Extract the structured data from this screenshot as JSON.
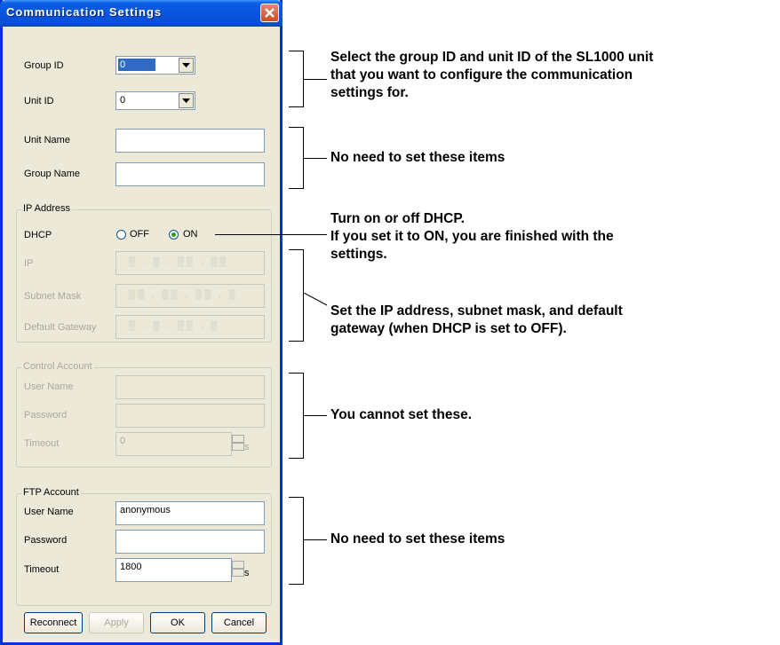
{
  "dialog": {
    "title": "Communication Settings",
    "close_icon": "close-icon"
  },
  "ids": {
    "group_id_label": "Group ID",
    "group_id_value": "0",
    "unit_id_label": "Unit ID",
    "unit_id_value": "0"
  },
  "names": {
    "unit_name_label": "Unit Name",
    "unit_name_value": "",
    "group_name_label": "Group Name",
    "group_name_value": ""
  },
  "ip": {
    "group_title": "IP Address",
    "dhcp_label": "DHCP",
    "off_label": "OFF",
    "on_label": "ON",
    "dhcp_selected": "ON",
    "ip_label": "IP",
    "subnet_label": "Subnet Mask",
    "gateway_label": "Default Gateway"
  },
  "control": {
    "group_title": "Control Account",
    "user_label": "User Name",
    "password_label": "Password",
    "timeout_label": "Timeout",
    "timeout_value": "0",
    "unit": "s"
  },
  "ftp": {
    "group_title": "FTP Account",
    "user_label": "User Name",
    "user_value": "anonymous",
    "password_label": "Password",
    "password_value": "",
    "timeout_label": "Timeout",
    "timeout_value": "1800",
    "unit": "s"
  },
  "buttons": {
    "reconnect": "Reconnect",
    "apply": "Apply",
    "ok": "OK",
    "cancel": "Cancel"
  },
  "annotations": {
    "a1_l1": "Select the group ID and unit ID of the SL1000 unit",
    "a1_l2": "that you want to configure the communication",
    "a1_l3": "settings for.",
    "a2": "No need to set these items",
    "a3_l1": "Turn on or off DHCP.",
    "a3_l2": "If you set it to ON, you are finished with the",
    "a3_l3": "settings.",
    "a4_l1": "Set the IP address, subnet mask, and default",
    "a4_l2": "gateway (when DHCP is set to OFF).",
    "a5": "You cannot set these.",
    "a6": "No need to set these items"
  }
}
